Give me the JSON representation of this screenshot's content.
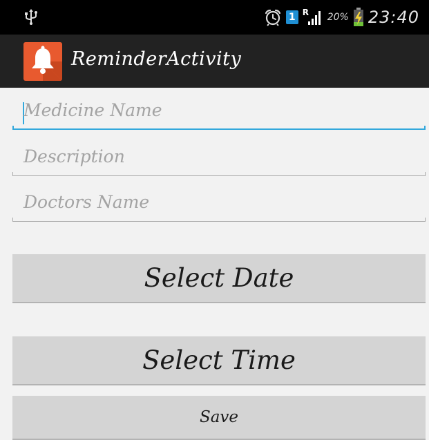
{
  "status_bar": {
    "icons": [
      "usb-icon",
      "alarm-clock-icon",
      "sim-icon",
      "signal-icon",
      "battery-charging-icon"
    ],
    "sim_label": "1",
    "roaming_mark": "R",
    "battery_percent": "20%",
    "time": "23:40"
  },
  "action_bar": {
    "title": "ReminderActivity",
    "icon": "bell-icon",
    "icon_color": "#e85a2f"
  },
  "form": {
    "medicine_name_placeholder": "Medicine Name",
    "description_placeholder": "Description",
    "doctors_name_placeholder": "Doctors Name",
    "select_date_label": "Select Date",
    "select_time_label": "Select Time",
    "save_label": "Save"
  },
  "colors": {
    "accent": "#33a8dc",
    "action_bar_bg": "#222222",
    "button_bg": "#d4d4d4"
  }
}
